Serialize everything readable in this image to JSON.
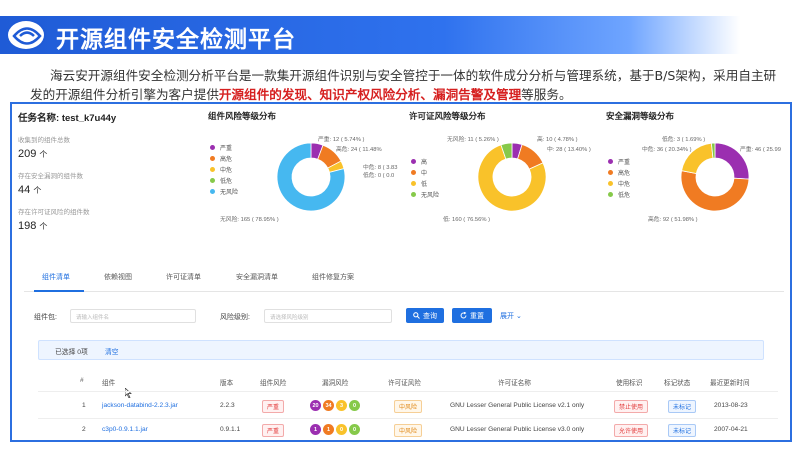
{
  "slide": {
    "title": "开源组件安全检测平台",
    "intro_plain": "海云安开源组件安全检测分析平台是一款集开源组件识别与安全管控于一体的软件成分分析与管理系统，基于B/S架构，采用自主研发的开源组件分析引擎为客户提供",
    "intro_highlight": "开源组件的发现、知识产权风险分析、漏洞告警及管理",
    "intro_tail": "等服务。"
  },
  "stats": {
    "task_label": "任务名称:",
    "task_name": "test_k7u44y",
    "items": [
      {
        "label": "收集到的组件总数",
        "value": "209",
        "unit": "个"
      },
      {
        "label": "存在安全漏洞的组件数",
        "value": "44",
        "unit": "个"
      },
      {
        "label": "存在许可证风险的组件数",
        "value": "198",
        "unit": "个"
      }
    ]
  },
  "charts": {
    "component_risk": {
      "title": "组件风险等级分布",
      "legend": [
        "严重",
        "高危",
        "中危",
        "低危",
        "无风险"
      ],
      "labels": {
        "a": "严重: 12 ( 5.74% )",
        "b": "高危: 24 ( 11.48%",
        "c": "中危: 8 ( 3.83",
        "d": "低危: 0 ( 0.0",
        "e": "无风险: 165 ( 78.95% )"
      }
    },
    "license_risk": {
      "title": "许可证风险等级分布",
      "legend": [
        "高",
        "中",
        "低",
        "无风险"
      ],
      "labels": {
        "a": "无风险: 11 ( 5.26% )",
        "b": "高: 10 ( 4.78% )",
        "c": "中: 28 ( 13.40% )",
        "d": "低: 160 ( 76.56% )"
      }
    },
    "vuln_level": {
      "title": "安全漏洞等级分布",
      "legend": [
        "严重",
        "高危",
        "中危",
        "低危"
      ],
      "labels": {
        "a": "低危: 3 ( 1.69% )",
        "b": "中危: 36 ( 20.34% )",
        "c": "严重: 46 ( 25.99",
        "d": "高危: 92 ( 51.98% )"
      }
    }
  },
  "chart_data": [
    {
      "type": "pie",
      "title": "组件风险等级分布",
      "categories": [
        "严重",
        "高危",
        "中危",
        "低危",
        "无风险"
      ],
      "values": [
        12,
        24,
        8,
        0,
        165
      ],
      "colors": [
        "#9b2fb0",
        "#f07b22",
        "#f9c22a",
        "#86c94a",
        "#46b8f0"
      ]
    },
    {
      "type": "pie",
      "title": "许可证风险等级分布",
      "categories": [
        "高",
        "中",
        "低",
        "无风险"
      ],
      "values": [
        10,
        28,
        160,
        11
      ],
      "colors": [
        "#9b2fb0",
        "#f07b22",
        "#f9c22a",
        "#86c94a"
      ]
    },
    {
      "type": "pie",
      "title": "安全漏洞等级分布",
      "categories": [
        "严重",
        "高危",
        "中危",
        "低危"
      ],
      "values": [
        46,
        92,
        36,
        3
      ],
      "colors": [
        "#9b2fb0",
        "#f07b22",
        "#f9c22a",
        "#86c94a"
      ]
    }
  ],
  "tabs": [
    "组件清单",
    "依赖视图",
    "许可证清单",
    "安全漏洞清单",
    "组件修复方案"
  ],
  "filters": {
    "package_label": "组件包:",
    "package_placeholder": "请输入组件名",
    "risk_label": "风险级别:",
    "risk_placeholder": "请选择风险级别",
    "query": "查询",
    "reset": "重置",
    "expand": "展开"
  },
  "selection": {
    "count": "已选择 0项",
    "clear": "清空"
  },
  "table": {
    "headers": [
      "#",
      "组件",
      "版本",
      "组件风险",
      "漏洞风险",
      "许可证风险",
      "许可证名称",
      "使用标识",
      "标记状态",
      "最近更新时间"
    ],
    "rows": [
      {
        "num": "1",
        "name": "jackson-databind-2.2.3.jar",
        "version": "2.2.3",
        "risk": "严重",
        "vulns": [
          "20",
          "34",
          "3",
          "0"
        ],
        "license_risk": "中风险",
        "license": "GNU Lesser General Public License v2.1 only",
        "usage": "禁止使用",
        "mark": "未标记",
        "updated": "2013-08-23"
      },
      {
        "num": "2",
        "name": "c3p0-0.9.1.1.jar",
        "version": "0.9.1.1",
        "risk": "严重",
        "vulns": [
          "1",
          "1",
          "0",
          "0"
        ],
        "license_risk": "中风险",
        "license": "GNU Lesser General Public License v3.0 only",
        "usage": "允许使用",
        "mark": "未标记",
        "updated": "2007-04-21"
      }
    ]
  },
  "colors": {
    "accent": "#1f6fe0",
    "critical": "#9b2fb0",
    "high": "#f07b22",
    "medium": "#f9c22a",
    "low": "#86c94a",
    "none": "#46b8f0"
  }
}
